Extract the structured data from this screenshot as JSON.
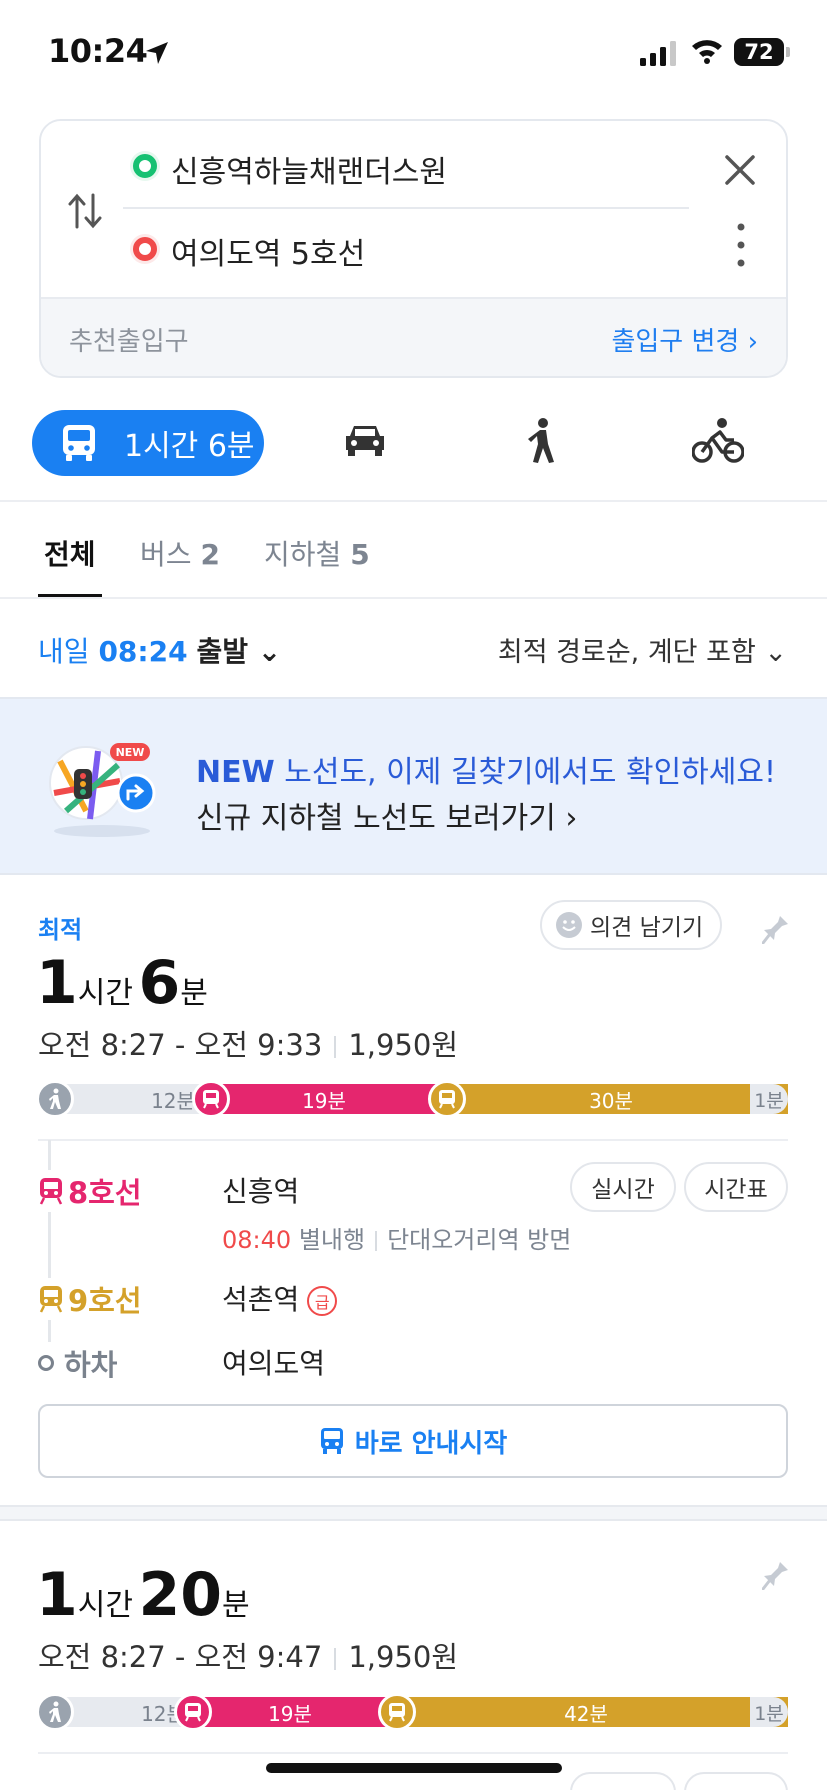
{
  "status_bar": {
    "time": "10:24",
    "battery": "72"
  },
  "search": {
    "origin": "신흥역하늘채랜더스원",
    "destination": "여의도역 5호선",
    "entrance_label": "추천출입구",
    "entrance_change": "출입구 변경 ›"
  },
  "modes": {
    "transit_duration": "1시간 6분",
    "active": "transit"
  },
  "route_tabs": [
    {
      "label": "전체",
      "count": ""
    },
    {
      "label": "버스",
      "count": "2"
    },
    {
      "label": "지하철",
      "count": "5"
    }
  ],
  "depart": {
    "day": "내일",
    "time": "08:24",
    "suffix": "출발 ⌄",
    "sort": "최적 경로순, 계단 포함 ⌄"
  },
  "banner": {
    "badge": "NEW",
    "highlight": "NEW",
    "line1": " 노선도, 이제 길찾기에서도 확인하세요!",
    "line2": "신규 지하철 노선도 보러가기 ›"
  },
  "routes": [
    {
      "tag": "최적",
      "feedback": "의견 남기기",
      "hours": "1",
      "hours_unit": "시간",
      "minutes": "6",
      "minutes_unit": "분",
      "depart_time": "오전 8:27 - 오전 9:33",
      "fare": "1,950원",
      "segments": {
        "walk": "12분",
        "line8": "19분",
        "line9": "30분",
        "end": "1분"
      },
      "steps": [
        {
          "line": "8호선",
          "station": "신흥역",
          "next_time": "08:40",
          "next_dest": "별내행",
          "direction": "단대오거리역 방면"
        },
        {
          "line": "9호선",
          "station": "석촌역",
          "badge": "급"
        },
        {
          "line": "하차",
          "station": "여의도역"
        }
      ],
      "realtime": "실시간",
      "timetable": "시간표",
      "start_guide": "바로 안내시작"
    },
    {
      "hours": "1",
      "hours_unit": "시간",
      "minutes": "20",
      "minutes_unit": "분",
      "depart_time": "오전 8:27 - 오전 9:47",
      "fare": "1,950원",
      "segments": {
        "walk": "12분",
        "line8": "19분",
        "line9": "42분",
        "end": "1분"
      }
    }
  ],
  "colors": {
    "accent": "#1a80f2",
    "line8": "#e5266e",
    "line9": "#d4a12a"
  }
}
